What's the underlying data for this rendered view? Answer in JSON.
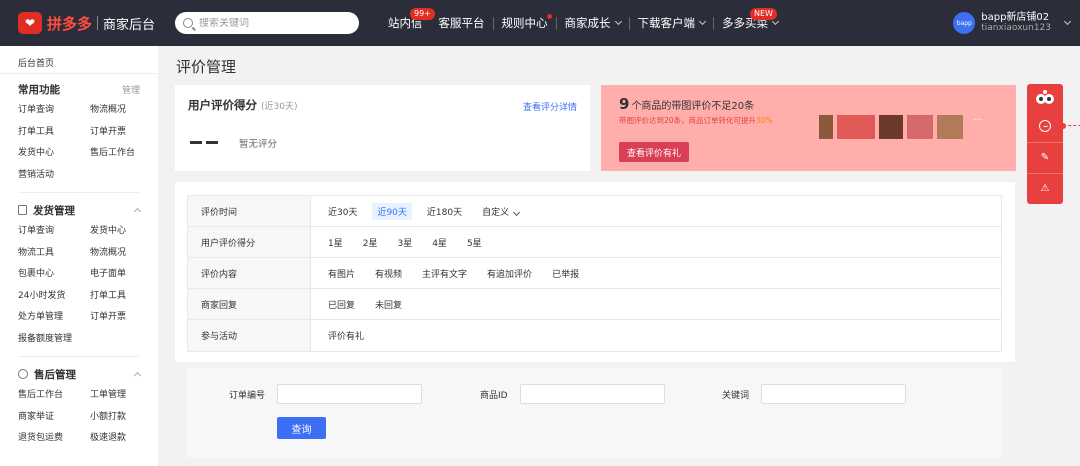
{
  "header": {
    "logo_icon": "pinduoduo-logo",
    "brand": "拼多多",
    "sub": "商家后台",
    "search_placeholder": "搜索关键词",
    "nav": [
      {
        "label": "站内信",
        "badge": "99+"
      },
      {
        "label": "客服平台"
      },
      {
        "label": "规则中心",
        "dot": true
      },
      {
        "label": "商家成长",
        "dropdown": true
      },
      {
        "label": "下载客户端",
        "dropdown": true
      },
      {
        "label": "多多买菜",
        "badge": "NEW",
        "dropdown": true
      }
    ],
    "user": {
      "avatar_text": "bapp",
      "name": "bapp新店铺02",
      "id": "tianxiaoxun123"
    }
  },
  "sidebar": {
    "home": "后台首页",
    "common": {
      "title": "常用功能",
      "manage": "管理",
      "items": [
        "订单查询",
        "物流概况",
        "打单工具",
        "订单开票",
        "发货中心",
        "售后工作台",
        "营销活动"
      ]
    },
    "shipping": {
      "title": "发货管理",
      "icon": "document-icon",
      "items": [
        "订单查询",
        "发货中心",
        "物流工具",
        "物流概况",
        "包裹中心",
        "电子面单",
        "24小时发货",
        "打单工具",
        "处方单管理",
        "订单开票",
        "报备额度管理"
      ]
    },
    "aftersale": {
      "title": "售后管理",
      "icon": "shield-check-icon",
      "items": [
        "售后工作台",
        "工单管理",
        "商家举证",
        "小额打款",
        "退货包运费",
        "极速退款"
      ]
    }
  },
  "page": {
    "title": "评价管理"
  },
  "score": {
    "title": "用户评价得分",
    "subtitle": "(近30天)",
    "link": "查看评分详情",
    "value": "--",
    "empty_text": "暂无评分"
  },
  "promo": {
    "count": "9",
    "title": "个商品的带图评价不足20条",
    "sub_prefix": "带图评价达到20条，商品订单转化可提升",
    "sub_highlight": "30%",
    "button": "查看评价有礼",
    "more": "···"
  },
  "filters": [
    {
      "label": "评价时间",
      "options": [
        "近30天",
        "近90天",
        "近180天",
        "自定义"
      ],
      "selected": 1
    },
    {
      "label": "用户评价得分",
      "options": [
        "1星",
        "2星",
        "3星",
        "4星",
        "5星"
      ]
    },
    {
      "label": "评价内容",
      "options": [
        "有图片",
        "有视频",
        "主评有文字",
        "有追加评价",
        "已举报"
      ]
    },
    {
      "label": "商家回复",
      "options": [
        "已回复",
        "未回复"
      ]
    },
    {
      "label": "参与活动",
      "options": [
        "评价有礼"
      ]
    }
  ],
  "search_form": {
    "order_label": "订单编号",
    "order_value": "",
    "goods_label": "商品ID",
    "goods_value": "",
    "keyword_label": "关键词",
    "keyword_value": "",
    "submit": "查询"
  },
  "float_tools": [
    "mascot-icon",
    "smile-icon",
    "edit-icon",
    "warning-icon"
  ],
  "colors": {
    "topbar": "#2b2d3a",
    "accent": "#3d6ff5",
    "brand": "#e02e24",
    "promo_bg": "#ffaeab"
  }
}
